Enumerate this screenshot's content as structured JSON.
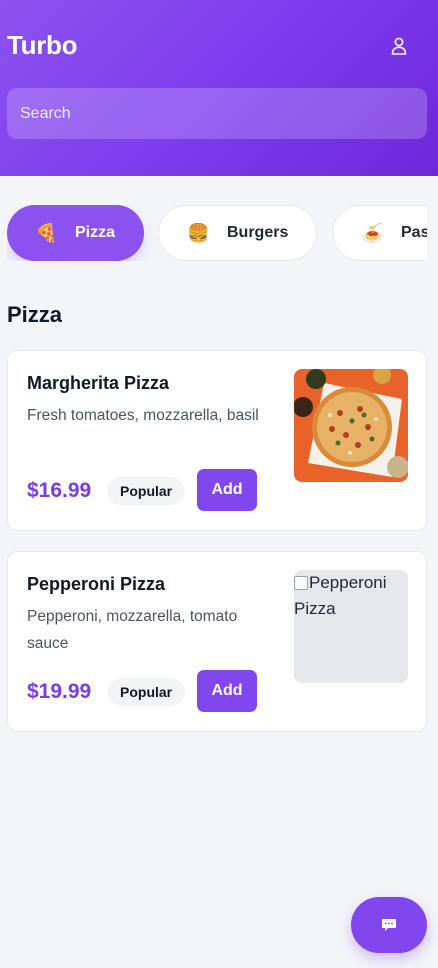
{
  "app": {
    "title": "Turbo"
  },
  "header": {
    "user_icon": "user-icon"
  },
  "search": {
    "placeholder": "Search",
    "value": ""
  },
  "categories": [
    {
      "label": "Pizza",
      "emoji": "🍕",
      "active": true
    },
    {
      "label": "Burgers",
      "emoji": "🍔",
      "active": false
    },
    {
      "label": "Pasta",
      "emoji": "🍝",
      "active": false
    }
  ],
  "section": {
    "title": "Pizza"
  },
  "items": [
    {
      "name": "Margherita Pizza",
      "description": "Fresh tomatoes, mozzarella, basil",
      "price": "$16.99",
      "badge": "Popular",
      "add_label": "Add",
      "image": "pizza-photo"
    },
    {
      "name": "Pepperoni Pizza",
      "description": "Pepperoni, mozzarella, tomato sauce",
      "price": "$19.99",
      "badge": "Popular",
      "add_label": "Add",
      "image_alt": "Pepperoni Pizza"
    }
  ],
  "fab": {
    "icon": "chat-icon"
  },
  "colors": {
    "accent": "#7c3aed",
    "accent_button": "#8146ee",
    "background": "#f3f5f8"
  }
}
